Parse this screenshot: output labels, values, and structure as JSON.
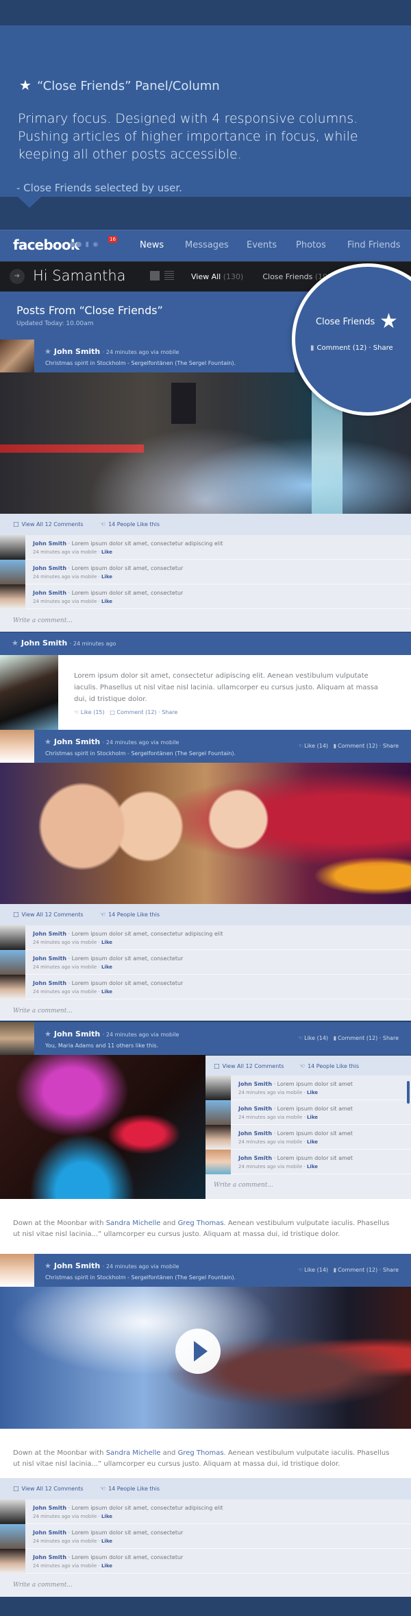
{
  "intro": {
    "title": "“Close Friends” Panel/Column",
    "body": "Primary focus. Designed with 4 responsive columns. Pushing articles of higher importance in focus, while keeping all other posts accessible.",
    "note": "- Close Friends selected by user.",
    "star_icon": "★"
  },
  "nav": {
    "logo": "facebook",
    "notification_count": "16",
    "links": [
      "News",
      "Messages",
      "Events",
      "Photos",
      "Find Friends"
    ],
    "active": "News"
  },
  "subbar": {
    "greeting": "Hi Samantha",
    "filters": [
      {
        "label": "View All",
        "count": "(130)"
      },
      {
        "label": "Close Friends",
        "count": "(19)"
      }
    ]
  },
  "header": {
    "title": "Posts From “Close Friends”",
    "updated": "Updated Today: 10.00am"
  },
  "circle": {
    "label": "Close Friends",
    "comment": "Comment (12)",
    "share": "Share"
  },
  "posts": [
    {
      "name": "John Smith",
      "time": "· 24 minutes ago via mobile",
      "caption": "Christmas spirit in Stockholm - Sergelfontänen (The Sergel Fountain).",
      "actions": {
        "like": "",
        "comment": "",
        "share": ""
      }
    },
    {
      "name": "John Smith",
      "time": "· 24 minutes ago",
      "body": "Lorem ipsum dolor sit amet, consectetur adipiscing elit. Aenean vestibulum vulputate iaculis. Phasellus ut nisl vitae nisl lacinia. ullamcorper eu cursus justo. Aliquam at massa dui, id tristique dolor.",
      "actions": {
        "like": "Like (15)",
        "comment": "Comment (12)",
        "share": "Share"
      }
    },
    {
      "name": "John Smith",
      "time": "· 24 minutes ago via mobile",
      "caption": "Christmas spirit in Stockholm - Sergelfontänen (The Sergel Fountain).",
      "actions": {
        "like": "Like (14)",
        "comment": "Comment (12)",
        "share": "Share"
      }
    },
    {
      "name": "John Smith",
      "time": "· 24 minutes ago via mobile",
      "caption": "You, Maria Adams and 11 others like this.",
      "actions": {
        "like": "Like (14)",
        "comment": "Comment (12)",
        "share": "Share"
      },
      "story": {
        "pre": "Down at the Moonbar with ",
        "link1": "Sandra Michelle",
        "mid": " and ",
        "link2": "Greg Thomas",
        "post": ". Aenean vestibulum vulputate iaculis. Phasellus ut nisl vitae nisl lacinia...” ullamcorper eu cursus justo. Aliquam at massa dui, id tristique dolor."
      }
    },
    {
      "name": "John Smith",
      "time": "· 24 minutes ago via mobile",
      "caption": "Christmas spirit in Stockholm - Sergelfontänen (The Sergel Fountain).",
      "actions": {
        "like": "Like (14)",
        "comment": "Comment (12)",
        "share": "Share"
      },
      "story": {
        "pre": "Down at the Moonbar with ",
        "link1": "Sandra Michelle",
        "mid": " and ",
        "link2": "Greg Thomas",
        "post": ". Aenean vestibulum vulputate iaculis. Phasellus ut nisl vitae nisl lacinia...” ullamcorper eu cursus justo. Aliquam at massa dui, id tristique dolor."
      }
    }
  ],
  "comments": {
    "view_all": "View All 12 Comments",
    "likes": "14 People Like this",
    "write_placeholder": "Write a comment...",
    "items": [
      {
        "name": "John Smith",
        "text": "· Lorem ipsum dolor sit amet, consectetur adipiscing elit",
        "meta": "24 minutes ago via mobile · ",
        "like": "Like"
      },
      {
        "name": "John Smith",
        "text": "· Lorem ipsum dolor sit amet, consectetur",
        "meta": "24 minutes ago via mobile · ",
        "like": "Like"
      },
      {
        "name": "John Smith",
        "text": "· Lorem ipsum dolor sit amet, consectetur",
        "meta": "24 minutes ago via mobile · ",
        "like": "Like"
      }
    ],
    "side_items": [
      {
        "name": "John Smith",
        "text": "· Lorem ipsum dolor sit amet",
        "meta": "24 minutes ago via mobile · ",
        "like": "Like"
      },
      {
        "name": "John Smith",
        "text": "· Lorem ipsum dolor sit amet",
        "meta": "24 minutes ago via mobile · ",
        "like": "Like"
      },
      {
        "name": "John Smith",
        "text": "· Lorem ipsum dolor sit amet",
        "meta": "24 minutes ago via mobile · ",
        "like": "Like"
      },
      {
        "name": "John Smith",
        "text": "· Lorem ipsum dolor sit amet",
        "meta": "24 minutes ago via mobile · ",
        "like": "Like"
      }
    ]
  },
  "icons": {
    "star": "★",
    "comment": "💬",
    "like": "👍"
  },
  "colors": {
    "brand_blue": "#3a5f9c",
    "dark_bg": "#27426b",
    "link_blue": "#3b5998",
    "badge_red": "#d8322a"
  }
}
